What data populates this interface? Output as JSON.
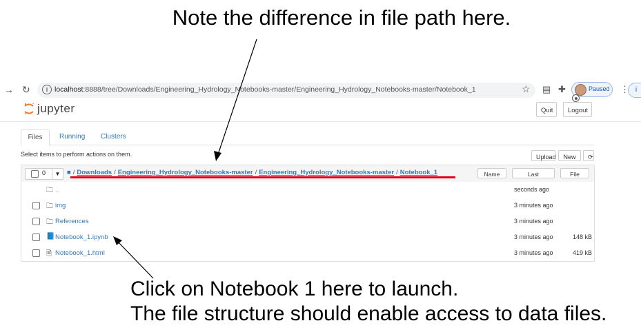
{
  "annotations": {
    "top_note": "Note the difference in file path here.",
    "bottom_line1": "Click on Notebook 1 here to launch.",
    "bottom_line2": "The file structure should enable access to data files."
  },
  "browser": {
    "url_host": "localhost",
    "url_path": ":8888/tree/Downloads/Engineering_Hydrology_Notebooks-master/Engineering_Hydrology_Notebooks-master/Notebook_1",
    "profile_status": "Paused",
    "ext_label": "i"
  },
  "header": {
    "logo_text": "jupyter",
    "quit_label": "Quit",
    "logout_label": "Logout"
  },
  "tabs": [
    {
      "label": "Files"
    },
    {
      "label": "Running"
    },
    {
      "label": "Clusters"
    }
  ],
  "toolbar": {
    "select_msg": "Select items to perform actions on them.",
    "upload_label": "Upload",
    "new_label": "New ▾",
    "refresh_icon": "⟳"
  },
  "list_header": {
    "selected_count": "0",
    "breadcrumb": [
      "Downloads",
      "Engineering_Hydrology_Notebooks-master",
      "Engineering_Hydrology_Notebooks-master",
      "Notebook_1"
    ],
    "sort_name": "Name ↓",
    "sort_modified": "Last Modified",
    "sort_size": "File size"
  },
  "files": [
    {
      "icon": "folder-icon",
      "name": "..",
      "modified": "seconds ago",
      "size": ""
    },
    {
      "icon": "folder-icon",
      "name": "img",
      "modified": "3 minutes ago",
      "size": ""
    },
    {
      "icon": "folder-icon",
      "name": "References",
      "modified": "3 minutes ago",
      "size": ""
    },
    {
      "icon": "notebook-icon",
      "name": "Notebook_1.ipynb",
      "modified": "3 minutes ago",
      "size": "148 kB"
    },
    {
      "icon": "file-icon",
      "name": "Notebook_1.html",
      "modified": "3 minutes ago",
      "size": "419 kB"
    }
  ],
  "colors": {
    "link": "#337ab7",
    "highlight": "#e0001b"
  }
}
